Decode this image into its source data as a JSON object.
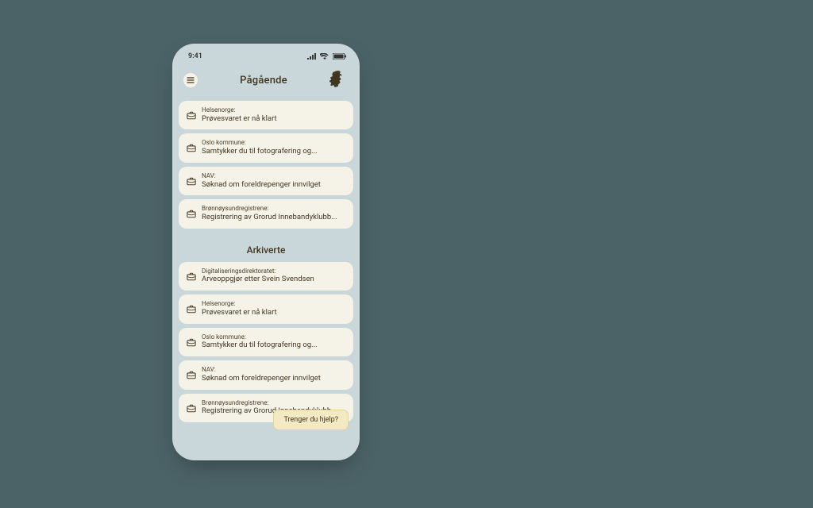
{
  "statusbar": {
    "time": "9:41"
  },
  "header": {
    "title": "Pågående",
    "menu_aria": "menu",
    "logo_aria": "norwegian-lion"
  },
  "sections": {
    "ongoing": {
      "label": "Pågående",
      "items": [
        {
          "sender": "Helsenorge:",
          "subject": "Prøvesvaret er nå klart"
        },
        {
          "sender": "Oslo kommune:",
          "subject": "Samtykker du til fotografering og..."
        },
        {
          "sender": "NAV:",
          "subject": "Søknad om foreldrepenger innvilget"
        },
        {
          "sender": "Brønnøysundregistrene:",
          "subject": "Registrering av Grorud Innebandyklubb..."
        }
      ]
    },
    "archived": {
      "label": "Arkiverte",
      "items": [
        {
          "sender": "Digitaliseringsdirektoratet:",
          "subject": "Arveoppgjør etter Svein Svendsen"
        },
        {
          "sender": "Helsenorge:",
          "subject": "Prøvesvaret er nå klart"
        },
        {
          "sender": "Oslo kommune:",
          "subject": "Samtykker du til fotografering og..."
        },
        {
          "sender": "NAV:",
          "subject": "Søknad om foreldrepenger innvilget"
        },
        {
          "sender": "Brønnøysundregistrene:",
          "subject": "Registrering av Grorud Innebandyklubb..."
        }
      ]
    }
  },
  "help": {
    "label": "Trenger du hjelp?"
  }
}
